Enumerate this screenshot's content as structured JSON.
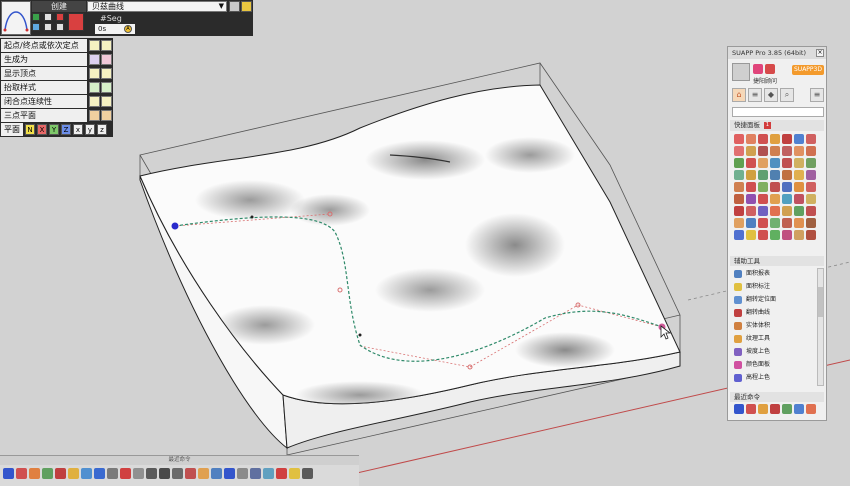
{
  "bezier_tool": {
    "create_label": "创建",
    "curve_type": "贝兹曲线",
    "seg_label": "#Seg",
    "seg_value": "0s",
    "seg_badge": "A"
  },
  "options": [
    {
      "label": "起点/终点或依次定点"
    },
    {
      "label": "生成为"
    },
    {
      "label": "显示顶点"
    },
    {
      "label": "抬取样式"
    },
    {
      "label": "闭合点连续性"
    },
    {
      "label": "三点平面"
    }
  ],
  "plane": {
    "label": "平面",
    "buttons": [
      "N",
      "X",
      "Y",
      "Z",
      "x",
      "y",
      "z"
    ]
  },
  "suapp": {
    "title": "SUAPP Pro 3.85 (64bit)",
    "user": "捷阳顾问",
    "vip_label": "SUAPP3D",
    "quick_panel": "快捷面板",
    "quick_badge": "1",
    "aux_header": "辅助工具",
    "aux_items": [
      "面积报表",
      "面积标注",
      "翻转定位面",
      "翻转曲线",
      "实体体积",
      "纹理工具",
      "坡度上色",
      "颜色面板",
      "高程上色"
    ],
    "recent_header": "最近命令"
  },
  "bottom_bar": {
    "title": "最近命令"
  },
  "colors": {
    "accent_orange": "#f39a2c",
    "ui_dark": "#2b2b2b",
    "curve": "#2f8a6a"
  }
}
